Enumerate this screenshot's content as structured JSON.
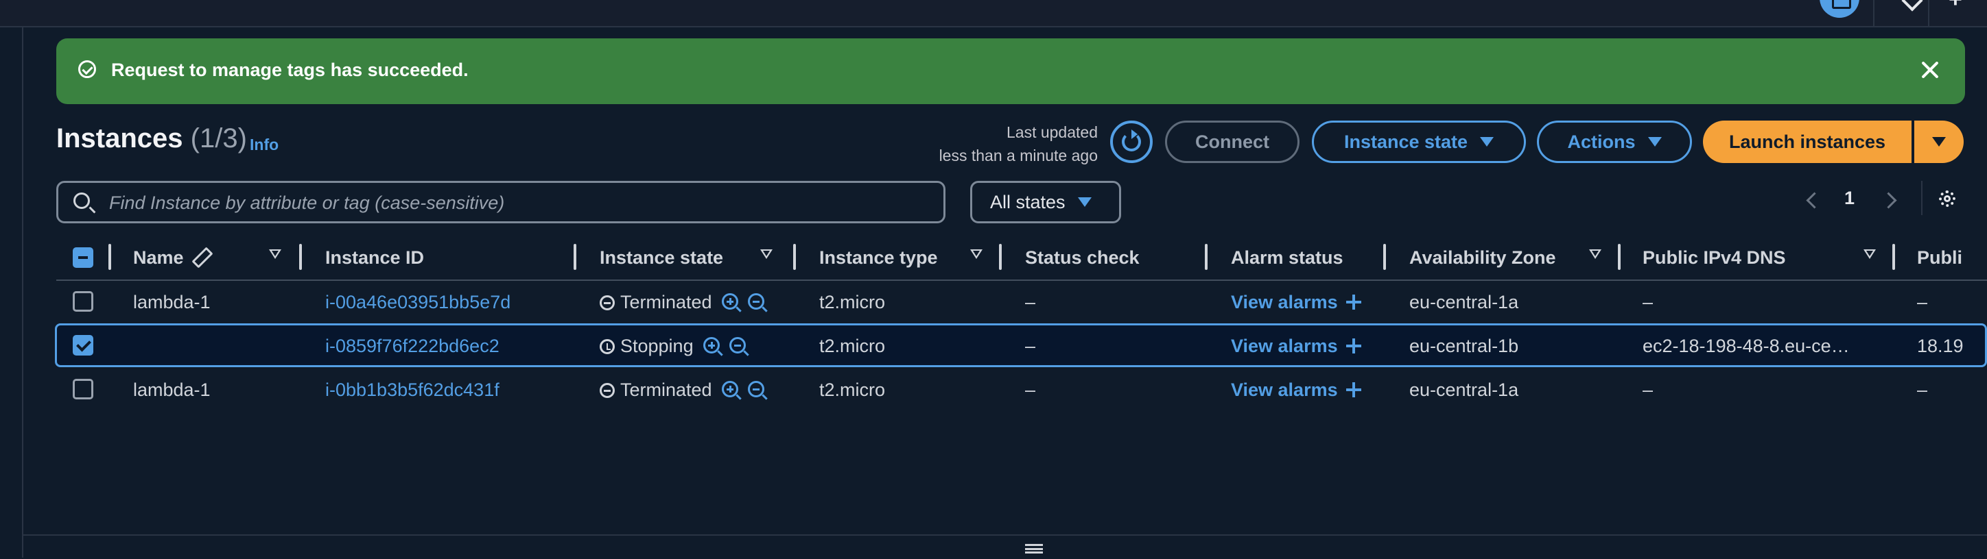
{
  "flash": {
    "message": "Request to manage tags has succeeded."
  },
  "header": {
    "title": "Instances",
    "count": "(1/3)",
    "info": "Info",
    "last_updated_label": "Last updated",
    "last_updated_value": "less than a minute ago"
  },
  "buttons": {
    "connect": "Connect",
    "instance_state": "Instance state",
    "actions": "Actions",
    "launch": "Launch instances"
  },
  "search": {
    "placeholder": "Find Instance by attribute or tag (case-sensitive)"
  },
  "filter": {
    "states": "All states"
  },
  "pagination": {
    "page": "1"
  },
  "columns": {
    "name": "Name",
    "instance_id": "Instance ID",
    "instance_state": "Instance state",
    "instance_type": "Instance type",
    "status_check": "Status check",
    "alarm_status": "Alarm status",
    "availability_zone": "Availability Zone",
    "public_dns": "Public IPv4 DNS",
    "public_ip": "Publi"
  },
  "rows": [
    {
      "name": "lambda-1",
      "id": "i-00a46e03951bb5e7d",
      "state": "Terminated",
      "type": "t2.micro",
      "status": "–",
      "alarm": "View alarms",
      "az": "eu-central-1a",
      "dns": "–",
      "ip": "–",
      "selected": false
    },
    {
      "name": "",
      "id": "i-0859f76f222bd6ec2",
      "state": "Stopping",
      "type": "t2.micro",
      "status": "–",
      "alarm": "View alarms",
      "az": "eu-central-1b",
      "dns": "ec2-18-198-48-8.eu-ce…",
      "ip": "18.19",
      "selected": true
    },
    {
      "name": "lambda-1",
      "id": "i-0bb1b3b5f62dc431f",
      "state": "Terminated",
      "type": "t2.micro",
      "status": "–",
      "alarm": "View alarms",
      "az": "eu-central-1a",
      "dns": "–",
      "ip": "–",
      "selected": false
    }
  ],
  "colors": {
    "accent": "#539fe5",
    "success": "#3a8240",
    "primary": "#f5a23a",
    "background": "#0f1b2a"
  }
}
